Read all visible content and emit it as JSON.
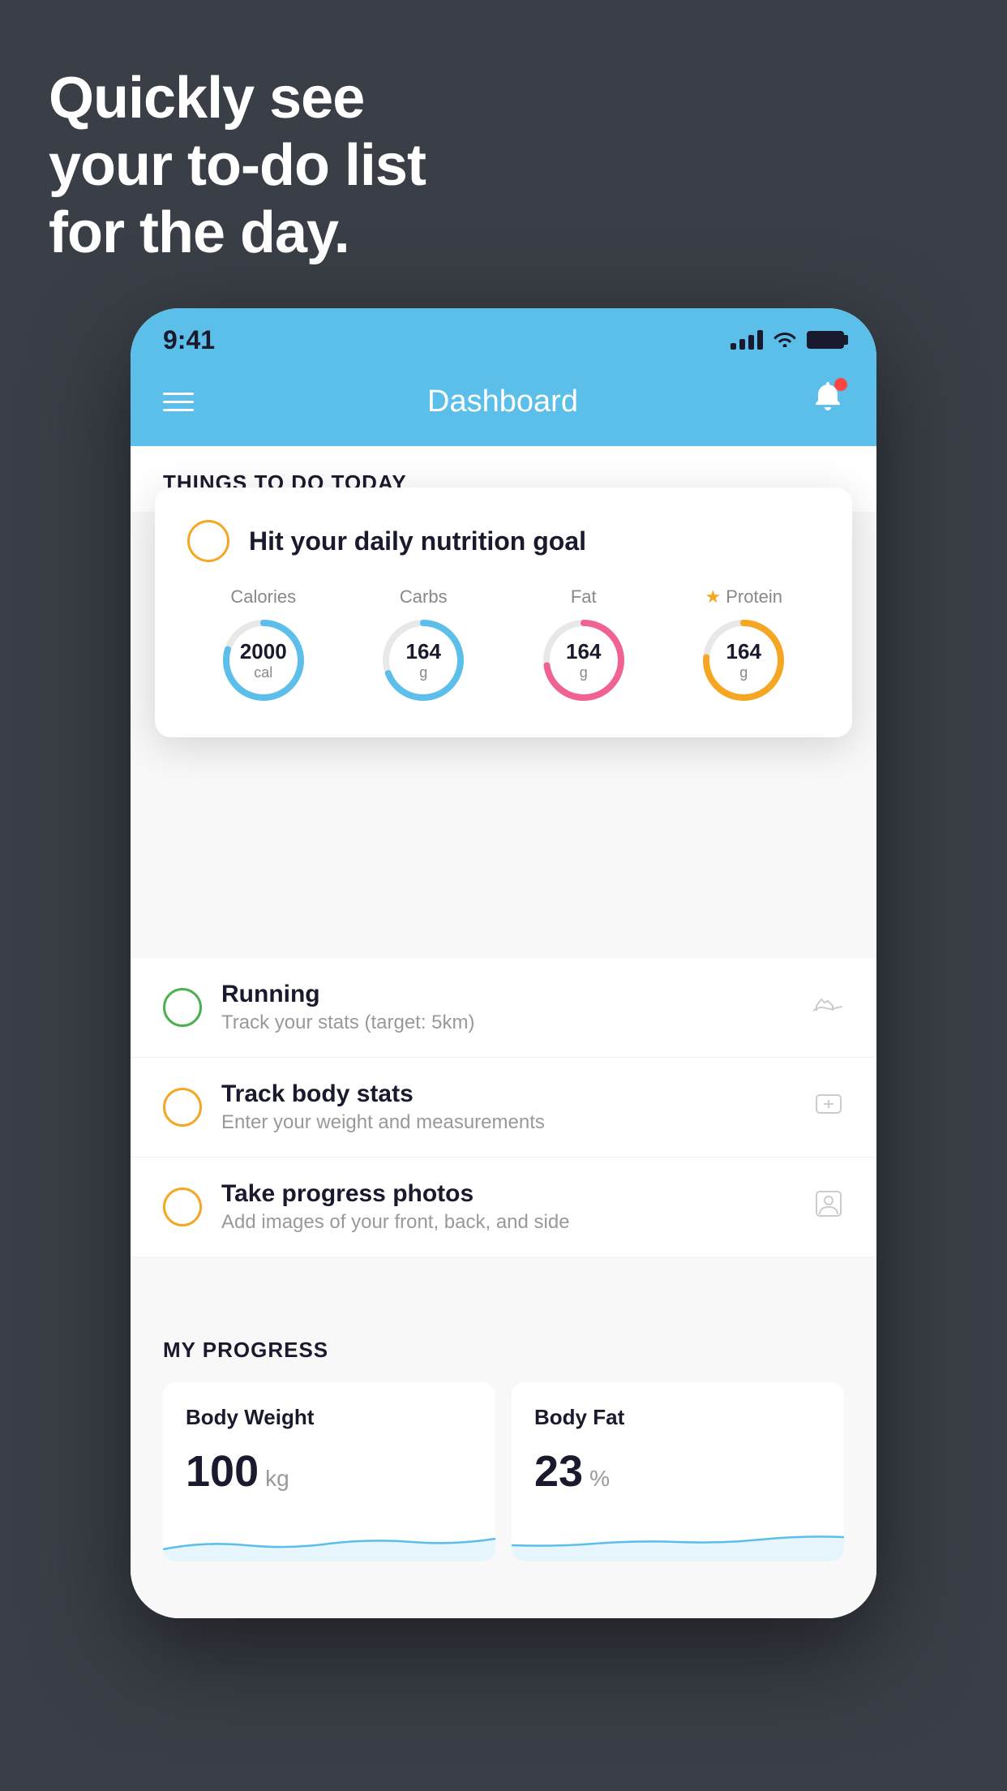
{
  "background": {
    "color": "#3a3f47"
  },
  "headline": {
    "line1": "Quickly see",
    "line2": "your to-do list",
    "line3": "for the day."
  },
  "phone": {
    "statusBar": {
      "time": "9:41"
    },
    "navBar": {
      "title": "Dashboard"
    },
    "thingsSection": {
      "title": "THINGS TO DO TODAY"
    },
    "floatingCard": {
      "title": "Hit your daily nutrition goal",
      "nutrition": [
        {
          "label": "Calories",
          "value": "2000",
          "unit": "cal",
          "color": "#5bbfea",
          "hasStar": false
        },
        {
          "label": "Carbs",
          "value": "164",
          "unit": "g",
          "color": "#5bbfea",
          "hasStar": false
        },
        {
          "label": "Fat",
          "value": "164",
          "unit": "g",
          "color": "#f06292",
          "hasStar": false
        },
        {
          "label": "Protein",
          "value": "164",
          "unit": "g",
          "color": "#f5a623",
          "hasStar": true
        }
      ]
    },
    "listItems": [
      {
        "title": "Running",
        "subtitle": "Track your stats (target: 5km)",
        "circleColor": "green",
        "icon": "👟"
      },
      {
        "title": "Track body stats",
        "subtitle": "Enter your weight and measurements",
        "circleColor": "yellow",
        "icon": "⚖️"
      },
      {
        "title": "Take progress photos",
        "subtitle": "Add images of your front, back, and side",
        "circleColor": "yellow",
        "icon": "👤"
      }
    ],
    "progressSection": {
      "title": "MY PROGRESS",
      "cards": [
        {
          "title": "Body Weight",
          "value": "100",
          "unit": "kg"
        },
        {
          "title": "Body Fat",
          "value": "23",
          "unit": "%"
        }
      ]
    }
  }
}
